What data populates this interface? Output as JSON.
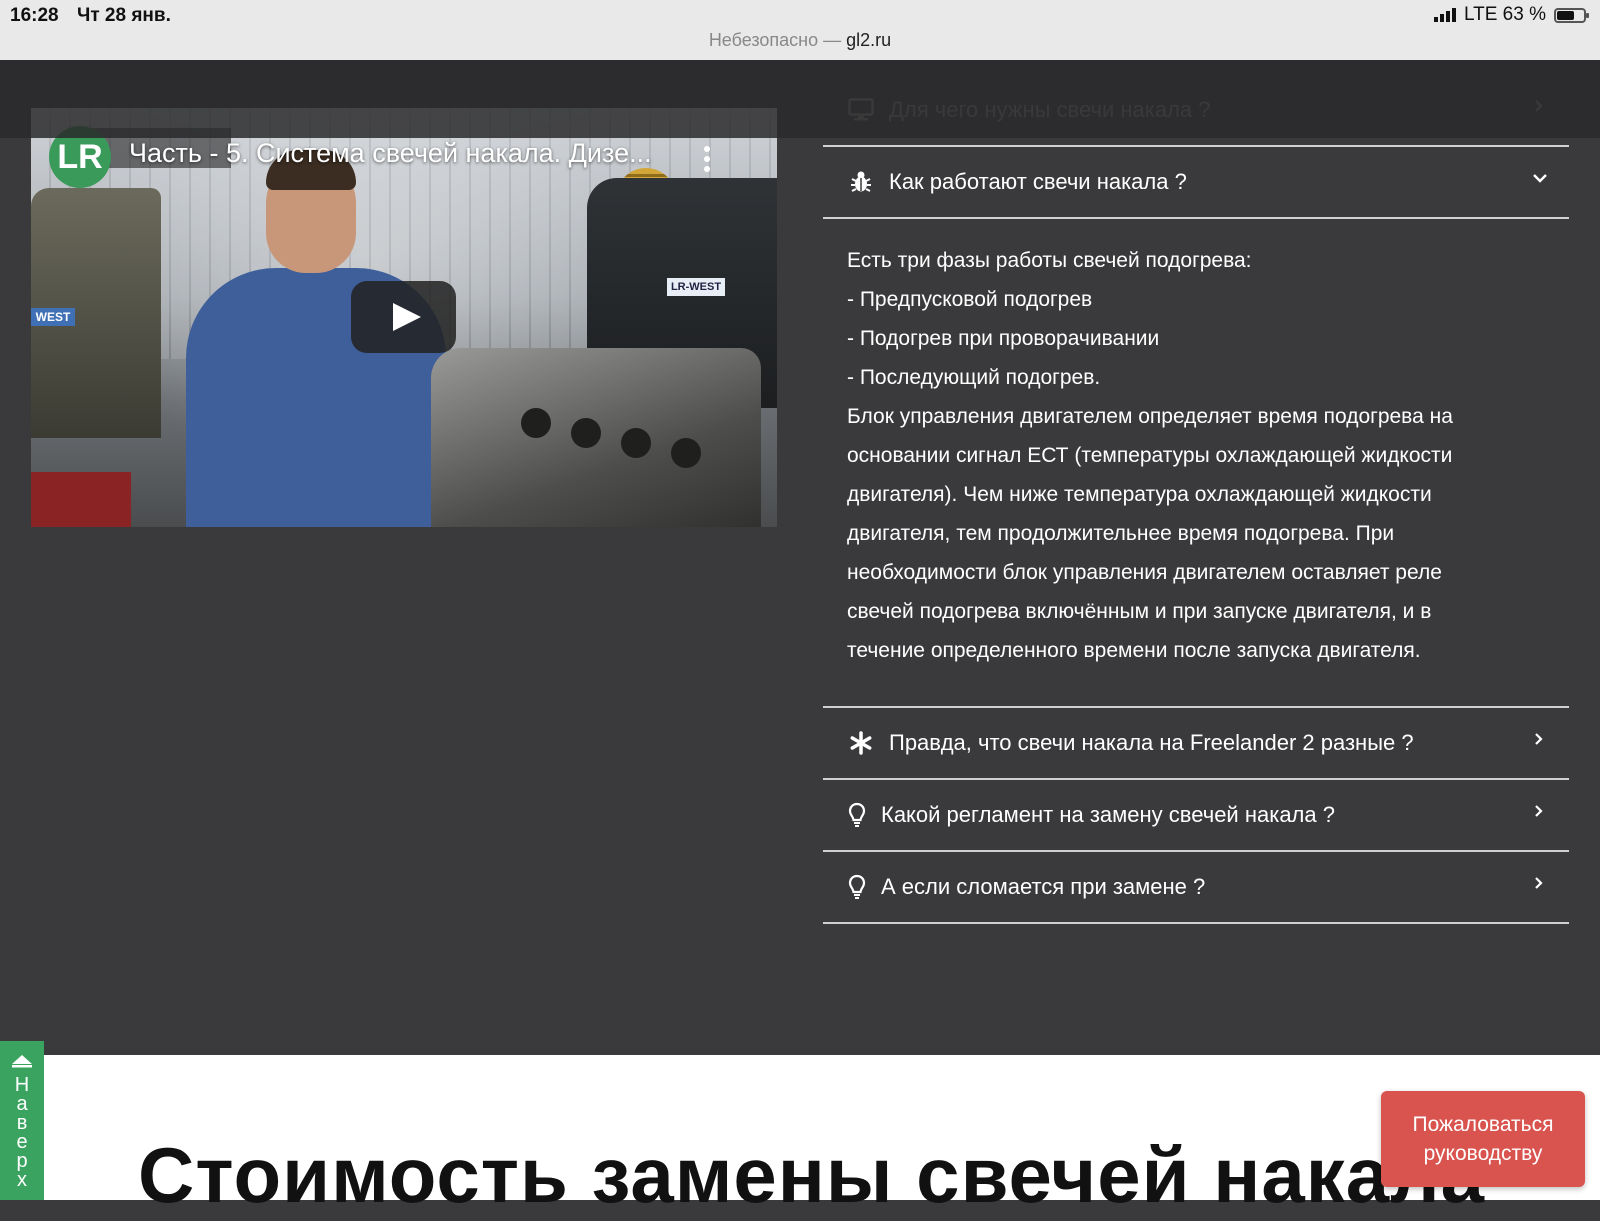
{
  "status": {
    "time": "16:28",
    "date": "Чт 28 янв.",
    "network": "LTE 63 %"
  },
  "browser": {
    "security": "Небезопасно —",
    "domain": "gl2.ru"
  },
  "video": {
    "logo": "LR",
    "title": "Часть - 5. Система свечей накала. Дизе...",
    "left_badge": "WEST",
    "plate": "LR-WEST"
  },
  "accordion": {
    "items": [
      {
        "label": "Для чего нужны свечи накала ?",
        "icon": "monitor-icon",
        "state": "collapsed"
      },
      {
        "label": "Как работают свечи накала ?",
        "icon": "bug-icon",
        "state": "expanded",
        "body": [
          "Есть три фазы работы свечей подогрева:",
          "- Предпусковой подогрев",
          "- Подогрев при проворачивании",
          "- Последующий подогрев.",
          "Блок управления двигателем определяет время подогрева на основании сигнал ЕСТ (температуры охлаждающей жидкости двигателя). Чем ниже температура охлаждающей жидкости двигателя, тем продолжительнее время подогрева. При необходимости блок управления двигателем оставляет реле свечей подогрева включённым и при запуске двигателя, и в течение определенного времени после запуска двигателя."
        ]
      },
      {
        "label": "Правда, что свечи накала на Freelander 2 разные ?",
        "icon": "asterisk-icon",
        "state": "collapsed"
      },
      {
        "label": "Какой регламент на замену свечей накала ?",
        "icon": "lightbulb-icon",
        "state": "collapsed"
      },
      {
        "label": "А если сломается при замене ?",
        "icon": "lightbulb-icon",
        "state": "collapsed"
      }
    ]
  },
  "section": {
    "title": "Стоимость замены свечей накала"
  },
  "up_button": {
    "label": "Наверх"
  },
  "complain_button": {
    "label": "Пожаловаться руководству"
  },
  "colors": {
    "background": "#3a3a3c",
    "up_green": "#3aa35f",
    "complain_red": "#d9534f"
  }
}
